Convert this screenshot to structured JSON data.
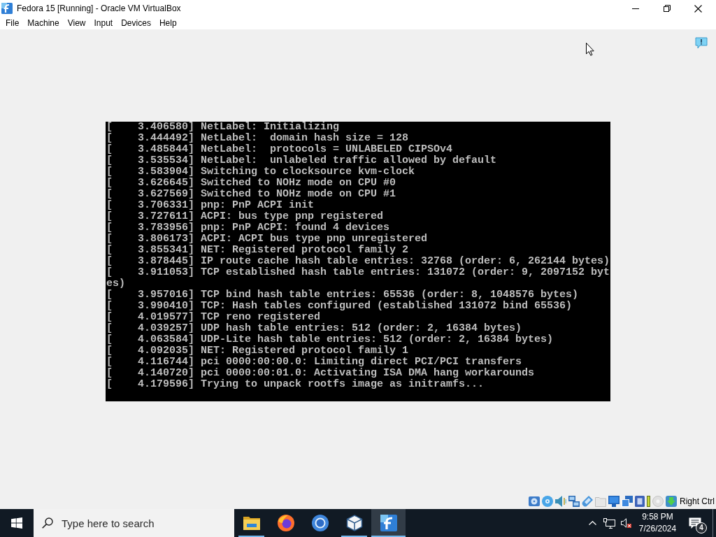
{
  "window": {
    "title": "Fedora 15 [Running] - Oracle VM VirtualBox"
  },
  "menu_bar": [
    "File",
    "Machine",
    "View",
    "Input",
    "Devices",
    "Help"
  ],
  "console": {
    "lines": [
      "[    3.406580] NetLabel: Initializing",
      "[    3.444492] NetLabel:  domain hash size = 128",
      "[    3.485844] NetLabel:  protocols = UNLABELED CIPSOv4",
      "[    3.535534] NetLabel:  unlabeled traffic allowed by default",
      "[    3.583904] Switching to clocksource kvm-clock",
      "[    3.626645] Switched to NOHz mode on CPU #0",
      "[    3.627569] Switched to NOHz mode on CPU #1",
      "[    3.706331] pnp: PnP ACPI init",
      "[    3.727611] ACPI: bus type pnp registered",
      "[    3.783956] pnp: PnP ACPI: found 4 devices",
      "[    3.806173] ACPI: ACPI bus type pnp unregistered",
      "[    3.855341] NET: Registered protocol family 2",
      "[    3.878445] IP route cache hash table entries: 32768 (order: 6, 262144 bytes)",
      "[    3.911053] TCP established hash table entries: 131072 (order: 9, 2097152 bytes)",
      "[    3.957016] TCP bind hash table entries: 65536 (order: 8, 1048576 bytes)",
      "[    3.990410] TCP: Hash tables configured (established 131072 bind 65536)",
      "[    4.019577] TCP reno registered",
      "[    4.039257] UDP hash table entries: 512 (order: 2, 16384 bytes)",
      "[    4.063584] UDP-Lite hash table entries: 512 (order: 2, 16384 bytes)",
      "[    4.092035] NET: Registered protocol family 1",
      "[    4.116744] pci 0000:00:00.0: Limiting direct PCI/PCI transfers",
      "[    4.140720] pci 0000:00:01.0: Activating ISA DMA hang workarounds",
      "[    4.179596] Trying to unpack rootfs image as initramfs..."
    ]
  },
  "status_bar": {
    "host_key": "Right Ctrl"
  },
  "taskbar": {
    "search": {
      "placeholder": "Type here to search"
    },
    "apps": [
      {
        "kind": "folder",
        "running": true,
        "selected": false
      },
      {
        "kind": "globe",
        "running": false,
        "selected": false
      },
      {
        "kind": "ring",
        "running": false,
        "selected": false
      },
      {
        "kind": "cube",
        "running": true,
        "selected": false
      },
      {
        "kind": "vm",
        "running": true,
        "selected": true
      }
    ],
    "clock": {
      "time": "9:58 PM",
      "date": "7/26/2024"
    },
    "notification_count": "4"
  }
}
